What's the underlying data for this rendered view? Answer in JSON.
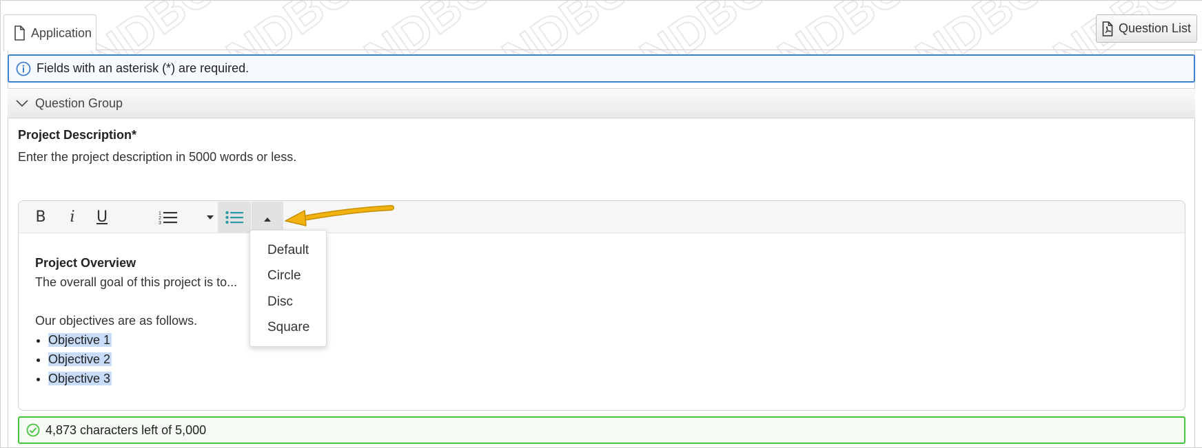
{
  "tabs": {
    "application_label": "Application",
    "question_list_label": "Question List"
  },
  "info": {
    "message": "Fields with an asterisk (*) are required."
  },
  "group": {
    "title": "Question Group"
  },
  "question": {
    "label": "Project Description*",
    "help": "Enter the project description in 5000 words or less."
  },
  "editor": {
    "toolbar": {
      "bold": "B",
      "italic": "i",
      "underline": "U"
    },
    "content": {
      "heading": "Project Overview",
      "line1": "The overall goal of this project is to...",
      "line2": "Our objectives are as follows.",
      "bullets": [
        "Objective 1",
        "Objective 2",
        "Objective 3"
      ]
    },
    "list_style_menu": [
      "Default",
      "Circle",
      "Disc",
      "Square"
    ]
  },
  "status": {
    "message": "4,873 characters left of 5,000"
  },
  "colors": {
    "info_border": "#3d7fd1",
    "success_border": "#43c43b",
    "accent_teal": "#2a9aa6",
    "arrow": "#f2b20f",
    "selection": "#c8dcf8"
  }
}
